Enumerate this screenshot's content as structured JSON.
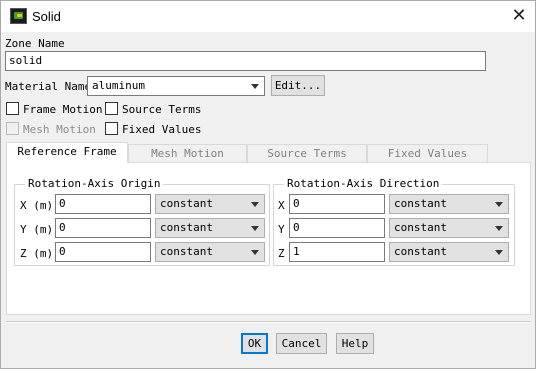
{
  "window": {
    "title": "Solid",
    "icon": "fluent-app-icon",
    "close_icon": "close-icon"
  },
  "zone": {
    "label": "Zone Name",
    "value": "solid"
  },
  "material": {
    "label": "Material Name",
    "value": "aluminum",
    "edit_label": "Edit..."
  },
  "options": {
    "frame_motion": {
      "label": "Frame Motion",
      "checked": false
    },
    "source_terms": {
      "label": "Source Terms",
      "checked": false
    },
    "mesh_motion": {
      "label": "Mesh Motion",
      "checked": false,
      "disabled": true
    },
    "fixed_values": {
      "label": "Fixed Values",
      "checked": false
    }
  },
  "tabs": [
    {
      "label": "Reference Frame",
      "active": true
    },
    {
      "label": "Mesh Motion",
      "active": false
    },
    {
      "label": "Source Terms",
      "active": false
    },
    {
      "label": "Fixed Values",
      "active": false
    }
  ],
  "origin": {
    "title": "Rotation-Axis Origin",
    "rows": [
      {
        "label": "X (m)",
        "value": "0",
        "method": "constant"
      },
      {
        "label": "Y (m)",
        "value": "0",
        "method": "constant"
      },
      {
        "label": "Z (m)",
        "value": "0",
        "method": "constant"
      }
    ]
  },
  "direction": {
    "title": "Rotation-Axis Direction",
    "rows": [
      {
        "label": "X",
        "value": "0",
        "method": "constant"
      },
      {
        "label": "Y",
        "value": "0",
        "method": "constant"
      },
      {
        "label": "Z",
        "value": "1",
        "method": "constant"
      }
    ]
  },
  "buttons": {
    "ok": "OK",
    "cancel": "Cancel",
    "help": "Help"
  }
}
